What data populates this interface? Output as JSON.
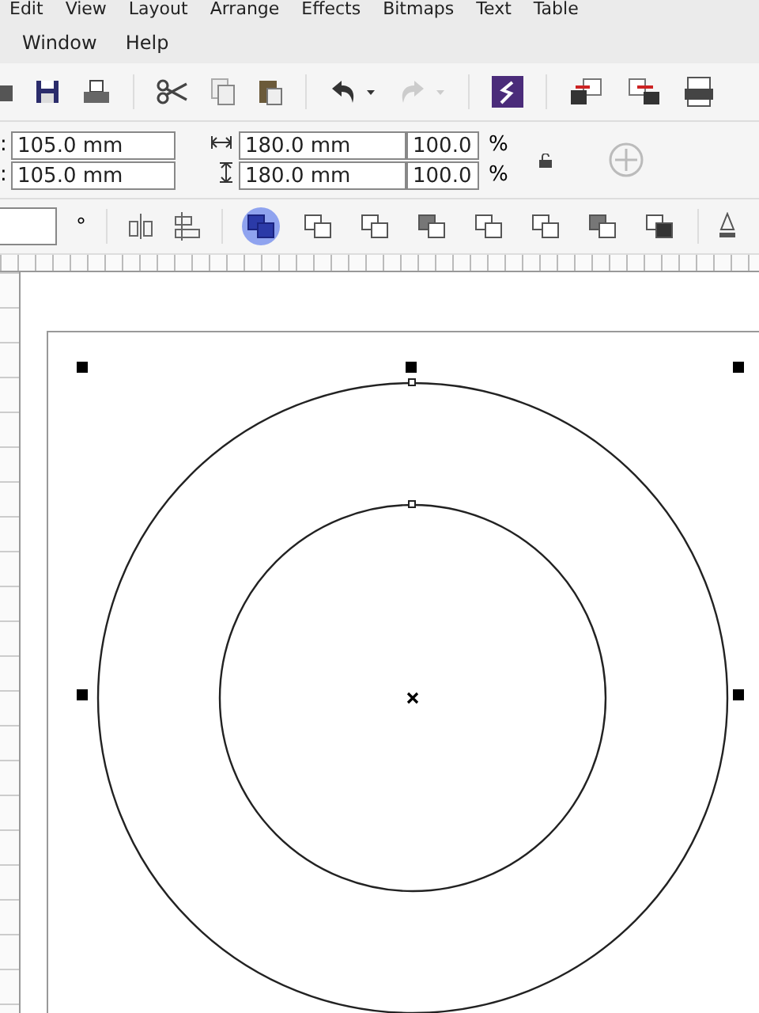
{
  "menu_bar": {
    "items": [
      "Edit",
      "View",
      "Layout",
      "Arrange",
      "Effects",
      "Bitmaps",
      "Text",
      "Table"
    ],
    "wrapped_items": [
      "Window",
      "Help"
    ]
  },
  "property_bar": {
    "position": [
      {
        "label": ":",
        "value": "105.0 mm"
      },
      {
        "label": ":",
        "value": "105.0 mm"
      }
    ],
    "size": [
      {
        "value": "180.0 mm"
      },
      {
        "value": "180.0 mm"
      }
    ],
    "scale": [
      {
        "value": "100.0",
        "unit": "%"
      },
      {
        "value": "100.0",
        "unit": "%"
      }
    ]
  },
  "object_bar": {
    "angle_unit": "°",
    "shaping_tools": [
      {
        "selected": true
      },
      {
        "selected": false
      },
      {
        "selected": false
      },
      {
        "selected": false
      },
      {
        "selected": false
      },
      {
        "selected": false
      },
      {
        "selected": false
      },
      {
        "selected": false
      }
    ]
  }
}
